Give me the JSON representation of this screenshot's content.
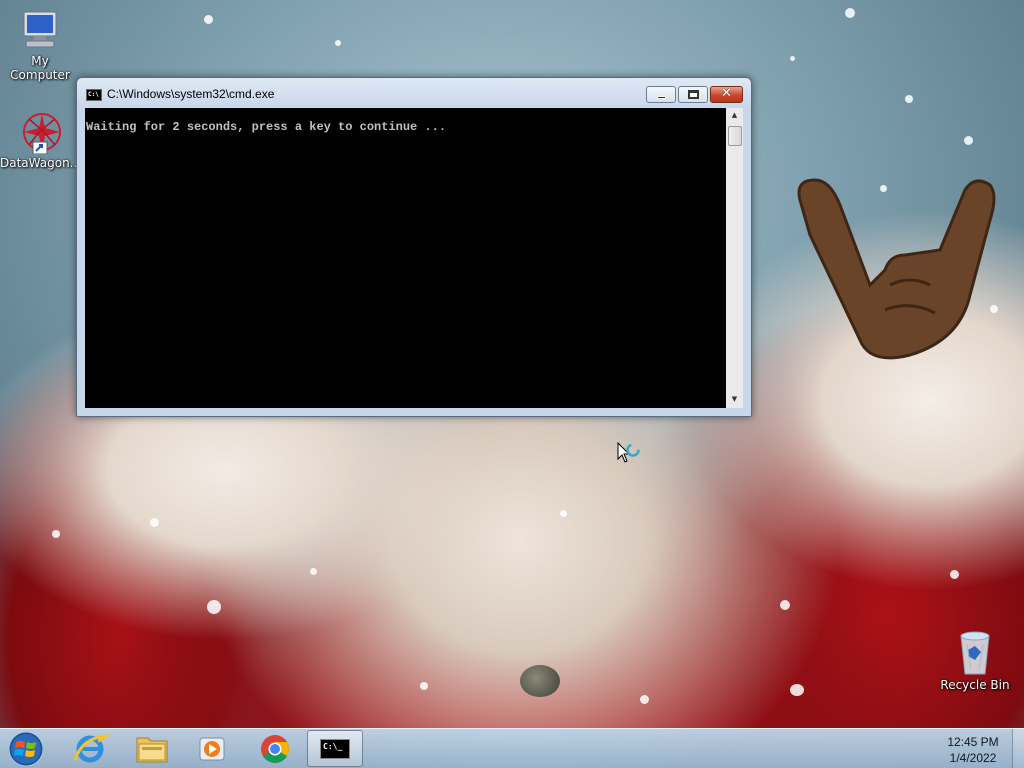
{
  "desktop": {
    "icons": [
      {
        "label": "My Computer",
        "icon": "my-computer-icon"
      },
      {
        "label": "DataWagon...",
        "icon": "datawagon-shortcut-icon"
      },
      {
        "label": "Recycle Bin",
        "icon": "recycle-bin-icon"
      }
    ]
  },
  "cmd_window": {
    "title": "C:\\Windows\\system32\\cmd.exe",
    "output": "Waiting for 2 seconds, press a key to continue ...",
    "minimize_glyph": "",
    "close_glyph": "✕",
    "scroll_up_glyph": "▲",
    "scroll_down_glyph": "▼",
    "title_icon_text": "C:\\"
  },
  "taskbar": {
    "items": [
      {
        "name": "start-button",
        "icon": "windows-logo-icon"
      },
      {
        "name": "internet-explorer",
        "icon": "internet-explorer-icon"
      },
      {
        "name": "file-explorer",
        "icon": "folder-icon"
      },
      {
        "name": "media-player",
        "icon": "media-player-icon"
      },
      {
        "name": "chrome",
        "icon": "chrome-icon"
      },
      {
        "name": "command-prompt",
        "icon": "cmd-icon",
        "active": true
      }
    ],
    "cmd_icon_text": "C:\\_",
    "clock": {
      "time": "12:45 PM",
      "date": "1/4/2022"
    }
  },
  "colors": {
    "console_bg": "#000000",
    "console_text": "#c0c0c0",
    "taskbar": "#aecbe0",
    "close_button": "#c8472f"
  }
}
